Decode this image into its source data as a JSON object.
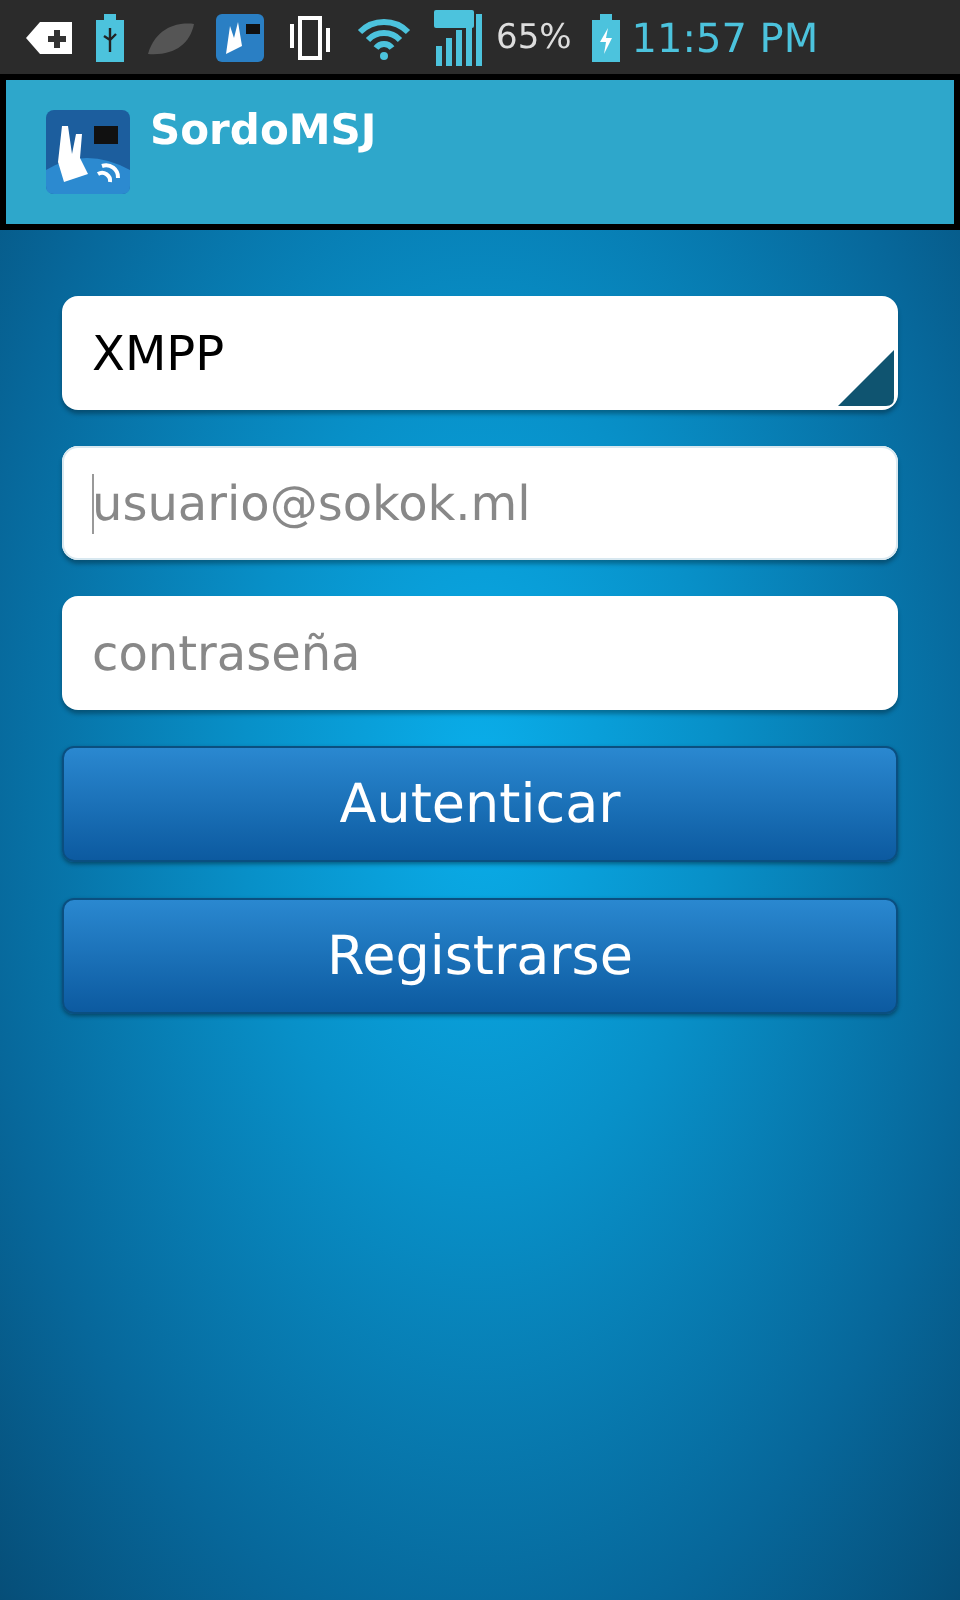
{
  "status_bar": {
    "battery": "65%",
    "time": "11:57 PM"
  },
  "app_bar": {
    "title": "SordoMSJ"
  },
  "form": {
    "protocol": {
      "value": "XMPP"
    },
    "fields": [
      {
        "placeholder": "usuario@sokok.ml",
        "focused": true
      },
      {
        "placeholder": "contraseña",
        "focused": false
      }
    ],
    "buttons": [
      "Autenticar",
      "Registrarse"
    ]
  }
}
